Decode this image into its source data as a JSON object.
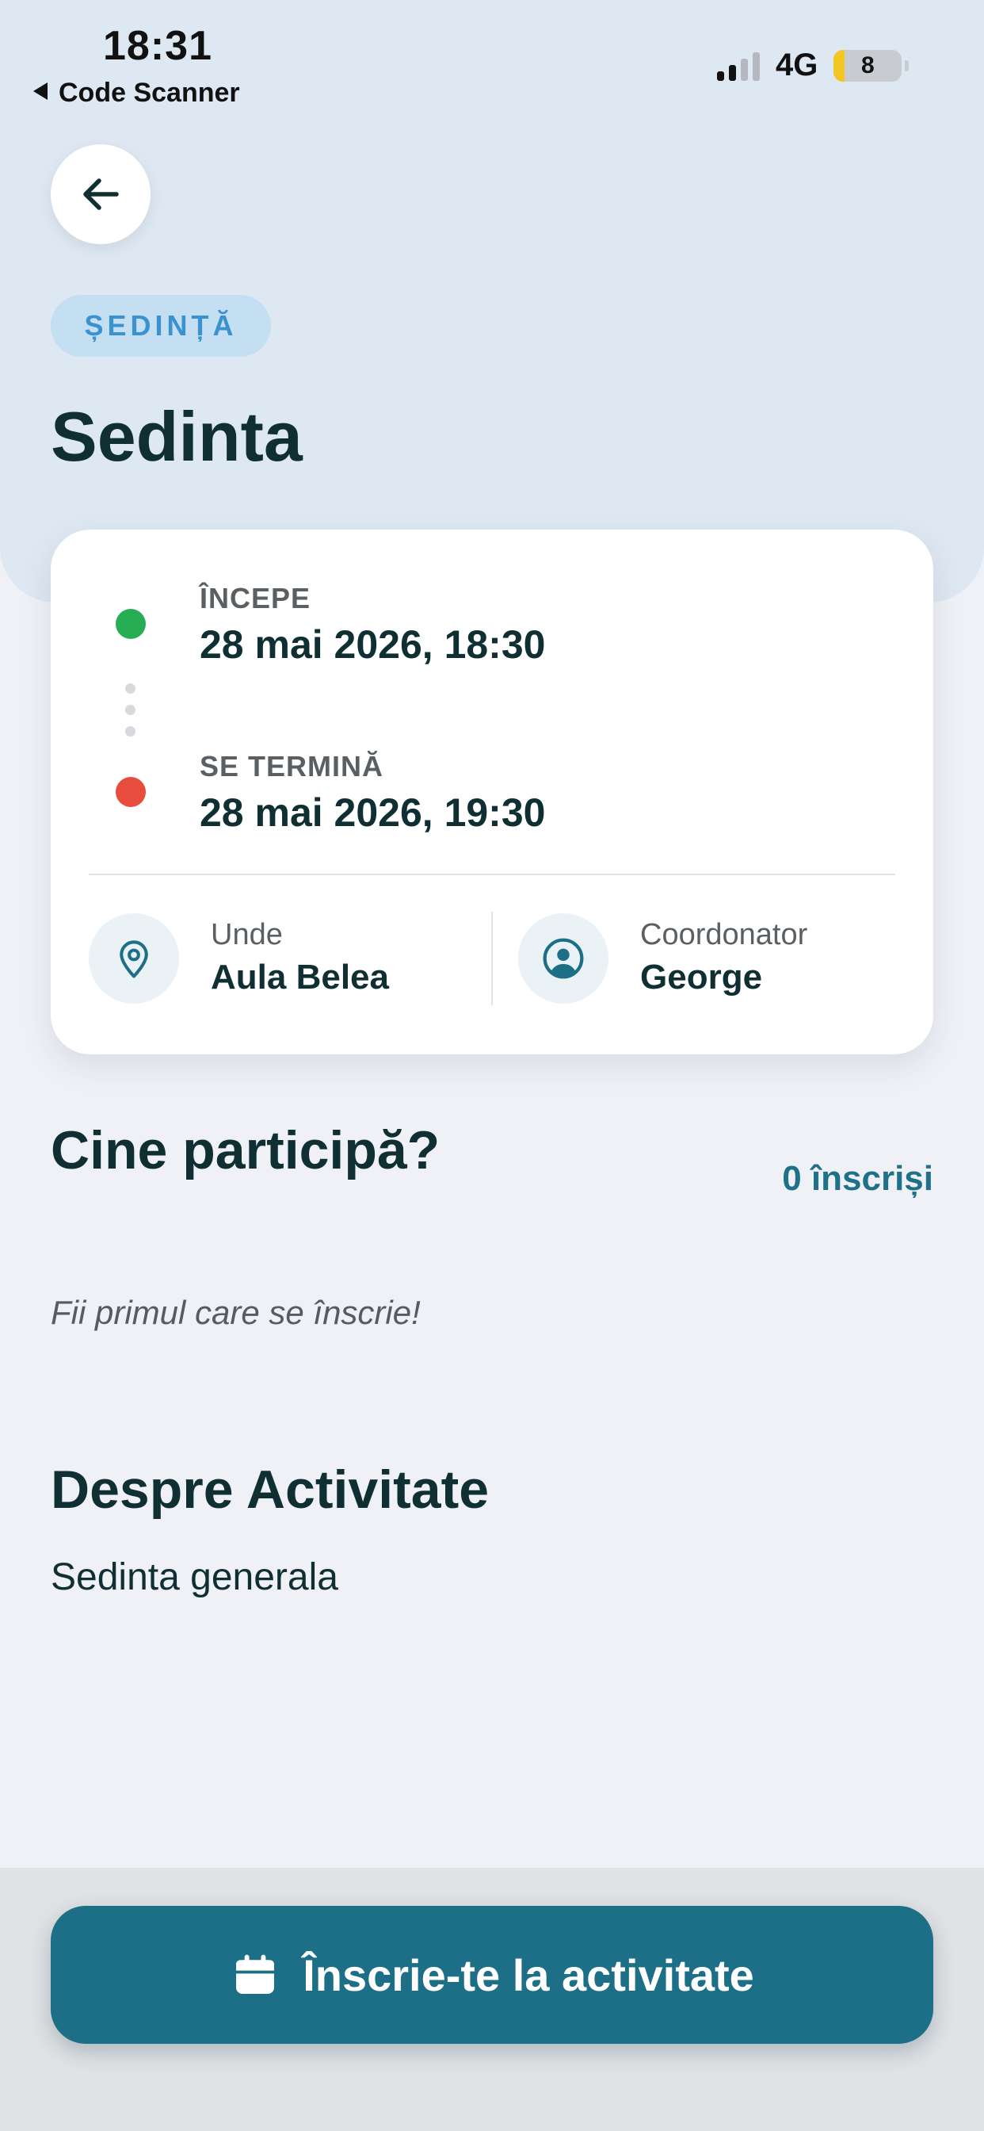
{
  "status_bar": {
    "time": "18:31",
    "back_app": "Code Scanner",
    "network": "4G",
    "battery": "8"
  },
  "header": {
    "tag": "ȘEDINȚĂ",
    "title": "Sedinta"
  },
  "schedule": {
    "start_label": "ÎNCEPE",
    "start_value": "28 mai 2026, 18:30",
    "end_label": "SE TERMINĂ",
    "end_value": "28 mai 2026, 19:30"
  },
  "location": {
    "label": "Unde",
    "value": "Aula Belea"
  },
  "coordinator": {
    "label": "Coordonator",
    "value": "George"
  },
  "participants": {
    "title": "Cine participă?",
    "count": "0 înscriși",
    "empty_text": "Fii primul care se înscrie!"
  },
  "about": {
    "title": "Despre Activitate",
    "text": "Sedinta generala"
  },
  "cta": {
    "label": "Înscrie-te la activitate"
  },
  "colors": {
    "accent": "#1d6f87",
    "start_dot": "#27ae54",
    "end_dot": "#e74c3c",
    "tag_bg": "#c4def2",
    "tag_text": "#3a93cf"
  }
}
